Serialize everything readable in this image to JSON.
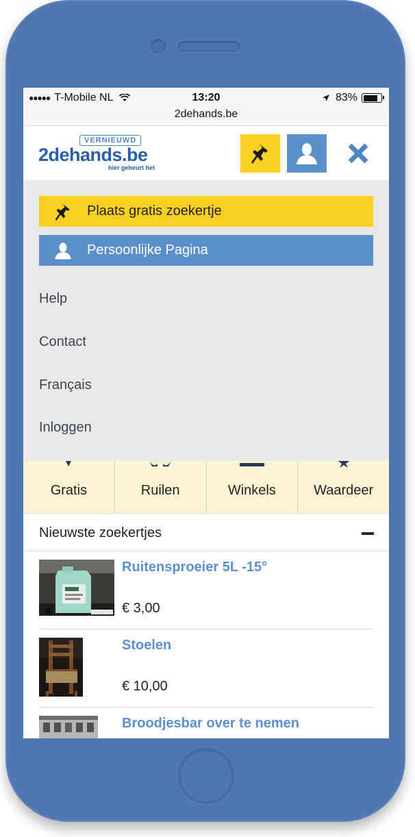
{
  "status_bar": {
    "carrier": "T-Mobile NL",
    "time": "13:20",
    "battery": "83%",
    "battery_level": 0.83,
    "url": "2dehands.be"
  },
  "header": {
    "logo_tag": "VERNIEUWD",
    "logo_text": "2dehands.be",
    "logo_tagline": "hier gebeurt het",
    "colors": {
      "yellow": "#f9d01f",
      "blue": "#5a8fcb",
      "logo": "#2a5ea8"
    }
  },
  "menu": {
    "place_ad_label": "Plaats gratis zoekertje",
    "personal_page_label": "Persoonlijke Pagina",
    "links": [
      "Help",
      "Contact",
      "Français",
      "Inloggen"
    ]
  },
  "categories": [
    "Gratis",
    "Ruilen",
    "Winkels",
    "Waardeer"
  ],
  "section": {
    "title": "Nieuwste zoekertjes"
  },
  "listings": [
    {
      "title": "Ruitensproeier 5L -15°",
      "price": "€ 3,00",
      "thumb_icon": "washer-fluid-photo"
    },
    {
      "title": "Stoelen",
      "price": "€ 10,00",
      "thumb_icon": "chair-photo"
    },
    {
      "title": "Broodjesbar over te nemen",
      "price": "",
      "thumb_icon": "building-photo"
    }
  ]
}
